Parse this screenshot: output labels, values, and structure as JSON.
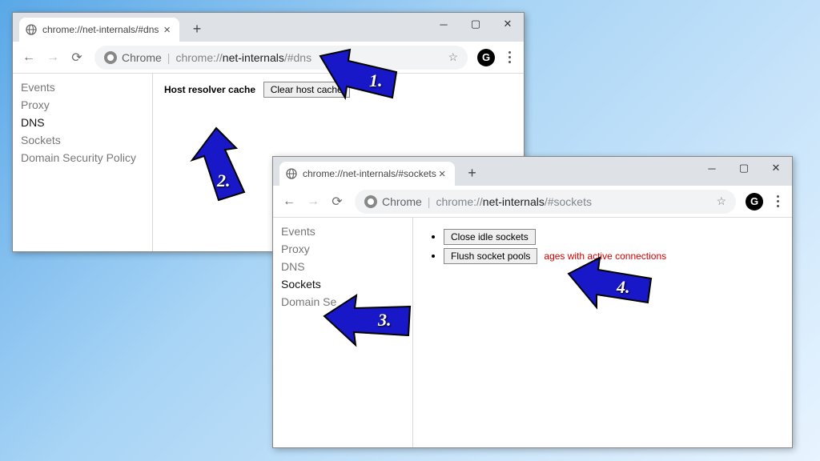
{
  "window1": {
    "tab_title": "chrome://net-internals/#dns",
    "omnibox_label": "Chrome",
    "url_prefix": "chrome://",
    "url_bold": "net-internals",
    "url_suffix": "/#dns",
    "sidebar": [
      "Events",
      "Proxy",
      "DNS",
      "Sockets",
      "Domain Security Policy"
    ],
    "active_index": 2,
    "host_resolver_label": "Host resolver cache",
    "clear_btn": "Clear host cache"
  },
  "window2": {
    "tab_title": "chrome://net-internals/#sockets",
    "omnibox_label": "Chrome",
    "url_prefix": "chrome://",
    "url_bold": "net-internals",
    "url_suffix": "/#sockets",
    "sidebar": [
      "Events",
      "Proxy",
      "DNS",
      "Sockets",
      "Domain Se"
    ],
    "active_index": 3,
    "btn_close_idle": "Close idle sockets",
    "btn_flush": "Flush socket pools",
    "warning_text": "ages with active connections"
  },
  "ext_letter": "G",
  "arrows": {
    "n1": "1.",
    "n2": "2.",
    "n3": "3.",
    "n4": "4."
  }
}
